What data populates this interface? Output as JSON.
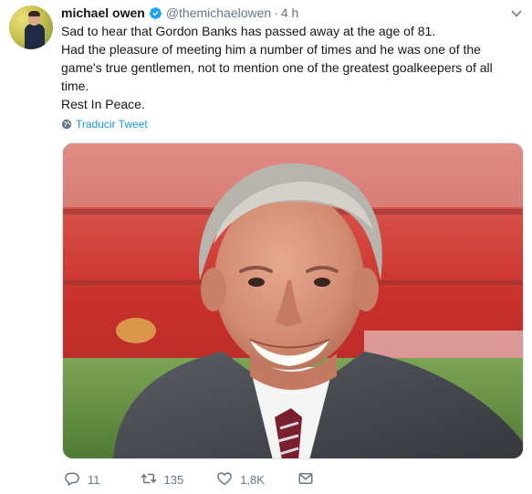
{
  "tweet": {
    "display_name": "michael owen",
    "handle": "@themichaelowen",
    "separator": "·",
    "time": "4 h",
    "lines": [
      "Sad to hear that Gordon Banks has passed away at the age of 81.",
      "Had the pleasure of meeting him a number of times and he was one of the game's true gentlemen, not to mention one of the greatest goalkeepers of all time.",
      "Rest In Peace."
    ],
    "translate_label": "Traducir Tweet"
  },
  "stats": {
    "replies": "11",
    "retweets": "135",
    "likes": "1,8K"
  },
  "colors": {
    "link_blue": "#1b95e0",
    "verified_blue": "#1da1f2",
    "muted": "#657786",
    "text": "#14171a"
  },
  "icons": {
    "verified": "verified-badge-icon",
    "caret": "chevron-down-icon",
    "translate": "globe-icon",
    "reply": "reply-icon",
    "retweet": "retweet-icon",
    "like": "heart-icon",
    "dm": "envelope-icon"
  }
}
